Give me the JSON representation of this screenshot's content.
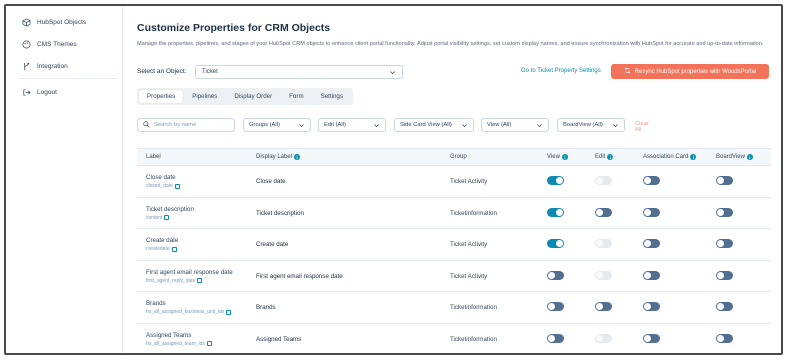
{
  "sidebar": {
    "items": [
      {
        "label": "HubSpot Objects",
        "icon": "cube-icon"
      },
      {
        "label": "CMS Themes",
        "icon": "palette-icon"
      },
      {
        "label": "Integration",
        "icon": "branch-icon"
      }
    ],
    "logout": {
      "label": "Logout",
      "icon": "logout-icon"
    }
  },
  "page": {
    "title": "Customize Properties for CRM Objects",
    "description": "Manage the properties, pipelines, and stages of your HubSpot CRM objects to enhance client portal functionality. Adjust portal visibility settings, set custom display names, and ensure synchronization with HubSpot for accurate and up-to-date information.",
    "select_label": "Select an Object:",
    "selected_object": "Ticket",
    "goto_link": "Go to Ticket Property Settings",
    "resync_label": "Resync HubSpot properties with WoodsPortal"
  },
  "tabs": [
    {
      "label": "Properties",
      "active": true
    },
    {
      "label": "Pipelines",
      "active": false
    },
    {
      "label": "Display Order",
      "active": false
    },
    {
      "label": "Form",
      "active": false
    },
    {
      "label": "Settings",
      "active": false
    }
  ],
  "filters": {
    "search_placeholder": "Search by name",
    "groups": "Groups (All)",
    "edit": "Edit (All)",
    "side_card_view": "Side Card View (All)",
    "view": "View (All)",
    "board_view": "BoardView (All)",
    "clear": "Clear All"
  },
  "table": {
    "headers": {
      "label": "Label",
      "display_label": "Display Label",
      "group": "Group",
      "view": "View",
      "edit": "Edit",
      "association_card": "Association Card",
      "board_view": "BoardView"
    },
    "rows": [
      {
        "label": "Close date",
        "api": "closed_date",
        "display": "Close date",
        "group": "Ticket Activity",
        "view": "on",
        "edit": "dis",
        "assoc": "off",
        "board": "off"
      },
      {
        "label": "Ticket description",
        "api": "content",
        "display": "Ticket description",
        "group": "Ticketinformation",
        "view": "on",
        "edit": "off",
        "assoc": "off",
        "board": "off"
      },
      {
        "label": "Create date",
        "api": "createdate",
        "display": "Create date",
        "group": "Ticket Activity",
        "view": "on",
        "edit": "dis",
        "assoc": "off",
        "board": "off"
      },
      {
        "label": "First agent email response date",
        "api": "first_agent_reply_date",
        "display": "First agent email response date",
        "group": "Ticket Activity",
        "view": "off",
        "edit": "dis",
        "assoc": "off",
        "board": "off"
      },
      {
        "label": "Brands",
        "api": "hs_all_assigned_business_unit_ids",
        "display": "Brands",
        "group": "Ticketinformation",
        "view": "off",
        "edit": "off",
        "assoc": "off",
        "board": "off"
      },
      {
        "label": "Assigned Teams",
        "api": "hs_all_assigned_team_ids",
        "display": "Assigned Teams",
        "group": "Ticketinformation",
        "view": "off",
        "edit": "dis",
        "assoc": "off",
        "board": "off"
      }
    ]
  },
  "colors": {
    "accent": "#0091ae",
    "resync_button": "#f2725a",
    "toggle_on": "#0b8bb0",
    "toggle_off": "#516f90"
  }
}
